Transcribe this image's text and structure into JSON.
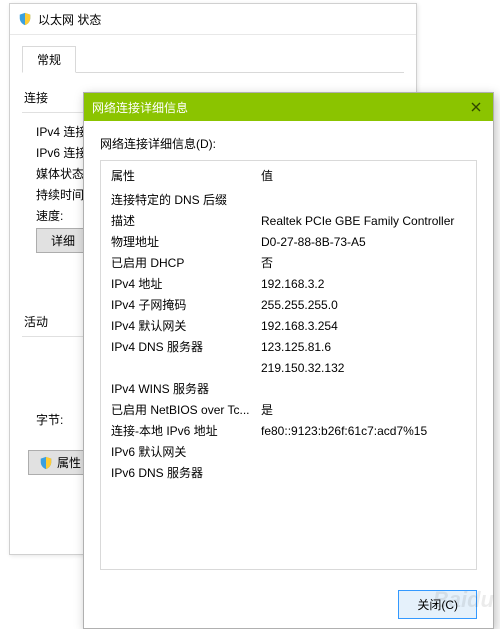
{
  "parent": {
    "title": "以太网 状态",
    "tab": "常规",
    "section_connection": "连接",
    "rows": {
      "ipv4": "IPv4 连接",
      "ipv6": "IPv6 连接",
      "media": "媒体状态",
      "duration": "持续时间",
      "speed": "速度:"
    },
    "details_btn": "详细",
    "section_activity": "活动",
    "bytes_label": "字节:",
    "properties_btn": "属性"
  },
  "child": {
    "title": "网络连接详细信息",
    "prompt": "网络连接详细信息(D):",
    "header_attr": "属性",
    "header_val": "值",
    "rows": [
      {
        "attr": "连接特定的 DNS 后缀",
        "val": ""
      },
      {
        "attr": "描述",
        "val": "Realtek PCIe GBE Family Controller"
      },
      {
        "attr": "物理地址",
        "val": "D0-27-88-8B-73-A5"
      },
      {
        "attr": "已启用 DHCP",
        "val": "否"
      },
      {
        "attr": "IPv4 地址",
        "val": "192.168.3.2"
      },
      {
        "attr": "IPv4 子网掩码",
        "val": "255.255.255.0"
      },
      {
        "attr": "IPv4 默认网关",
        "val": "192.168.3.254"
      },
      {
        "attr": "IPv4 DNS 服务器",
        "val": "123.125.81.6"
      },
      {
        "attr": "",
        "val": "219.150.32.132"
      },
      {
        "attr": "IPv4 WINS 服务器",
        "val": ""
      },
      {
        "attr": "已启用 NetBIOS over Tc...",
        "val": "是"
      },
      {
        "attr": "连接-本地 IPv6 地址",
        "val": "fe80::9123:b26f:61c7:acd7%15"
      },
      {
        "attr": "IPv6 默认网关",
        "val": ""
      },
      {
        "attr": "IPv6 DNS 服务器",
        "val": ""
      }
    ],
    "close_btn": "关闭(C)"
  },
  "watermark": "Baidu"
}
